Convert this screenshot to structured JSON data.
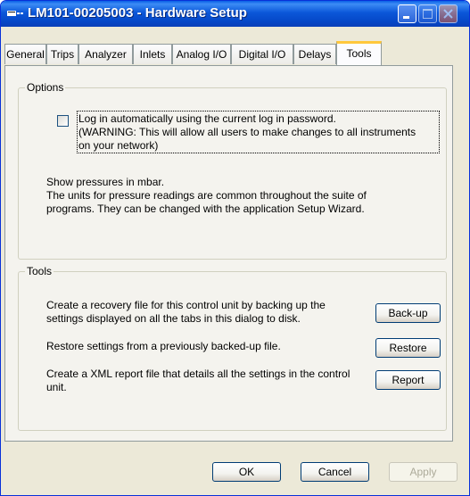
{
  "window": {
    "title": "LM101-00205003 - Hardware Setup",
    "title_bar_color": "#0a5fe6"
  },
  "tabs": [
    {
      "label": "General",
      "active": false
    },
    {
      "label": "Trips",
      "active": false
    },
    {
      "label": "Analyzer",
      "active": false
    },
    {
      "label": "Inlets",
      "active": false
    },
    {
      "label": "Analog I/O",
      "active": false
    },
    {
      "label": "Digital I/O",
      "active": false
    },
    {
      "label": "Delays",
      "active": false
    },
    {
      "label": "Tools",
      "active": true
    }
  ],
  "options": {
    "group_label": "Options",
    "auto_login": {
      "checked": false,
      "lines": [
        "Log in automatically using the current log in password.",
        "(WARNING: This will allow all users to make changes to all instruments",
        "on your network)"
      ]
    },
    "pressure_lines": [
      "Show pressures in mbar.",
      "The units for pressure readings are common throughout the suite of",
      "programs.  They can be changed with the application Setup Wizard."
    ]
  },
  "tools": {
    "group_label": "Tools",
    "backup": {
      "description": [
        "Create a recovery file for this control unit by backing up the",
        "settings displayed on all the tabs in this dialog to disk."
      ],
      "button_label": "Back-up"
    },
    "restore": {
      "description": [
        "Restore settings from a previously backed-up file."
      ],
      "button_label": "Restore"
    },
    "report": {
      "description": [
        "Create a XML report file that details all the settings in the control",
        "unit."
      ],
      "button_label": "Report"
    }
  },
  "footer": {
    "ok_label": "OK",
    "cancel_label": "Cancel",
    "apply_label": "Apply",
    "apply_enabled": false
  },
  "icons": {
    "app": "network-device-icon",
    "minimize": "minimize-icon",
    "maximize": "maximize-icon",
    "close": "close-icon"
  }
}
